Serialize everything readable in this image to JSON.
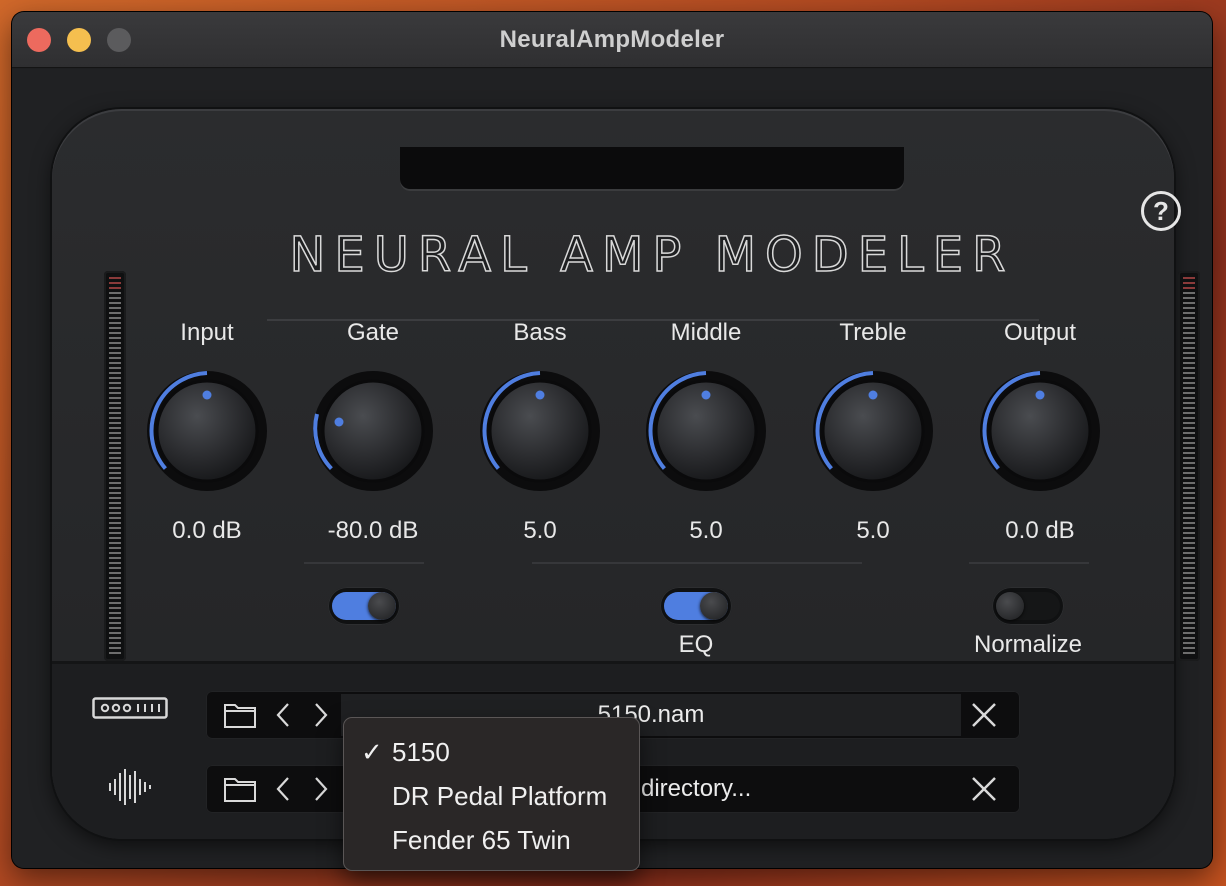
{
  "window": {
    "title": "NeuralAmpModeler"
  },
  "plugin": {
    "brand": "NEURAL AMP MODELER",
    "help_icon": "?",
    "accent_color": "#4f7ee0",
    "knobs": [
      {
        "label": "Input",
        "value": "0.0 dB"
      },
      {
        "label": "Gate",
        "value": "-80.0 dB"
      },
      {
        "label": "Bass",
        "value": "5.0"
      },
      {
        "label": "Middle",
        "value": "5.0"
      },
      {
        "label": "Treble",
        "value": "5.0"
      },
      {
        "label": "Output",
        "value": "0.0 dB"
      }
    ],
    "toggles": {
      "gate": {
        "label": "",
        "state": "on"
      },
      "eq": {
        "label": "EQ",
        "state": "on"
      },
      "normalize": {
        "label": "Normalize",
        "state": "off"
      }
    },
    "model_row": {
      "icon": "amp-model-icon",
      "file": "5150.nam"
    },
    "ir_row": {
      "icon": "waveform-icon",
      "file": "directory..."
    }
  },
  "dropdown": {
    "items": [
      {
        "label": "5150",
        "checked": true,
        "check": "✓"
      },
      {
        "label": "DR Pedal Platform",
        "checked": false
      },
      {
        "label": "Fender 65 Twin",
        "checked": false
      }
    ]
  }
}
